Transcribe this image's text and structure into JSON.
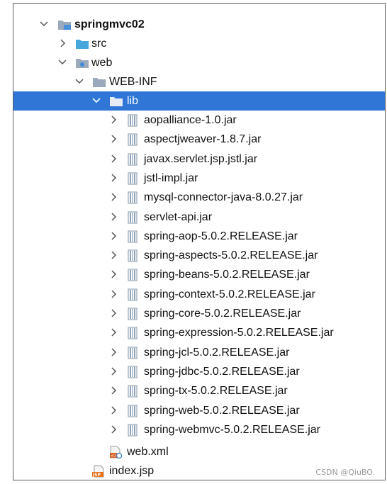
{
  "tree": {
    "project": {
      "label": "springmvc02",
      "icon": "project-folder-icon"
    },
    "src": {
      "label": "src",
      "icon": "source-folder-icon"
    },
    "web": {
      "label": "web",
      "icon": "web-folder-icon"
    },
    "webinf": {
      "label": "WEB-INF",
      "icon": "folder-icon"
    },
    "lib": {
      "label": "lib",
      "icon": "folder-icon",
      "selected": true
    },
    "jars": [
      {
        "label": "aopalliance-1.0.jar"
      },
      {
        "label": "aspectjweaver-1.8.7.jar"
      },
      {
        "label": "javax.servlet.jsp.jstl.jar"
      },
      {
        "label": "jstl-impl.jar"
      },
      {
        "label": "mysql-connector-java-8.0.27.jar"
      },
      {
        "label": "servlet-api.jar"
      },
      {
        "label": "spring-aop-5.0.2.RELEASE.jar"
      },
      {
        "label": "spring-aspects-5.0.2.RELEASE.jar"
      },
      {
        "label": "spring-beans-5.0.2.RELEASE.jar"
      },
      {
        "label": "spring-context-5.0.2.RELEASE.jar"
      },
      {
        "label": "spring-core-5.0.2.RELEASE.jar"
      },
      {
        "label": "spring-expression-5.0.2.RELEASE.jar"
      },
      {
        "label": "spring-jcl-5.0.2.RELEASE.jar"
      },
      {
        "label": "spring-jdbc-5.0.2.RELEASE.jar"
      },
      {
        "label": "spring-tx-5.0.2.RELEASE.jar"
      },
      {
        "label": "spring-web-5.0.2.RELEASE.jar"
      },
      {
        "label": "spring-webmvc-5.0.2.RELEASE.jar"
      }
    ],
    "webxml": {
      "label": "web.xml",
      "icon": "xml-file-icon"
    },
    "indexjsp": {
      "label": "index.jsp",
      "icon": "jsp-file-icon"
    }
  },
  "watermark": "CSDN @QiuBO.",
  "colors": {
    "selection": "#2f76d6",
    "folder": "#9aa9bb",
    "jar": "#8fa3b8"
  }
}
